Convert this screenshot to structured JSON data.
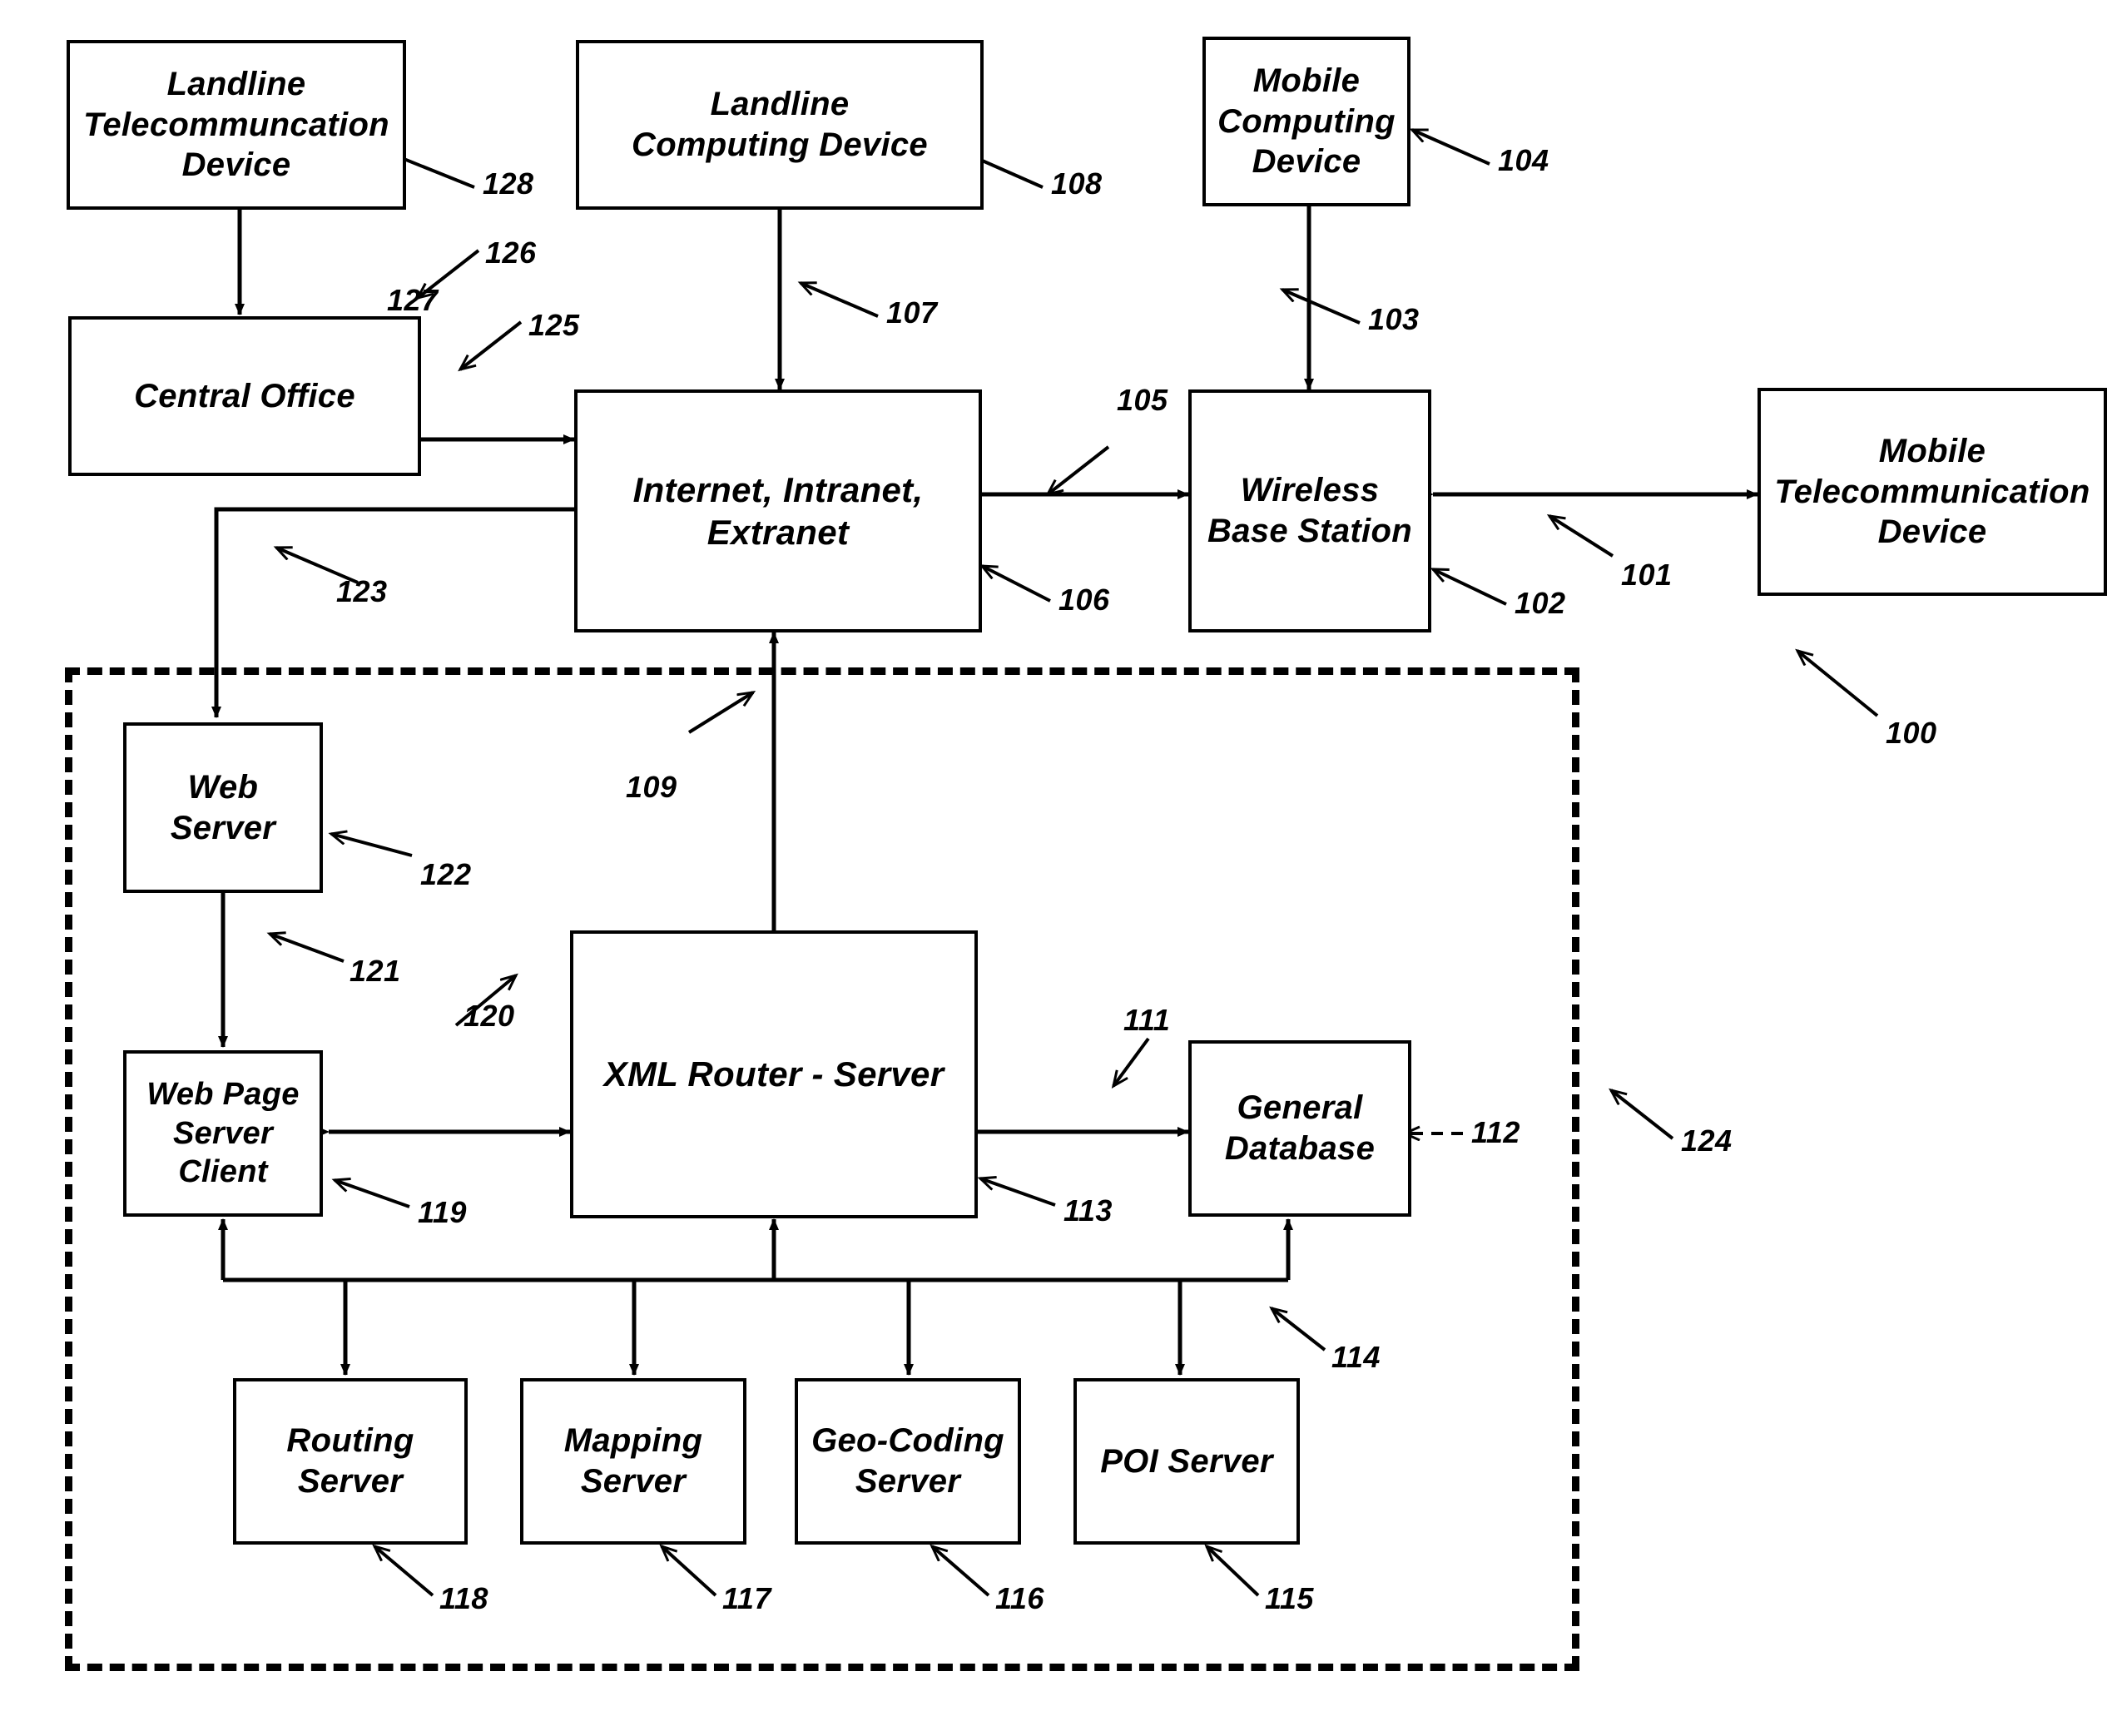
{
  "figure": {
    "type": "patent-system-block-diagram",
    "background_color": "#ffffff",
    "line_color": "#000000"
  },
  "nodes": [
    {
      "id": "n128",
      "label": "Landline\nTelecommuncation\nDevice",
      "ref": "128"
    },
    {
      "id": "n108",
      "label": "Landline\nComputing Device",
      "ref": "108"
    },
    {
      "id": "n104",
      "label": "Mobile\nComputing\nDevice",
      "ref": "104"
    },
    {
      "id": "n127",
      "label": "Central Office",
      "ref": "127"
    },
    {
      "id": "n106",
      "label": "Internet, Intranet,\nExtranet",
      "ref": "106"
    },
    {
      "id": "n102",
      "label": "Wireless\nBase Station",
      "ref": "102"
    },
    {
      "id": "n100",
      "label": "Mobile\nTelecommunication\nDevice",
      "ref": "100"
    },
    {
      "id": "n122",
      "label": "Web\nServer",
      "ref": "122"
    },
    {
      "id": "n119",
      "label": "Web Page\nServer\nClient",
      "ref": "119"
    },
    {
      "id": "n113",
      "label": "XML Router - Server",
      "ref": "113"
    },
    {
      "id": "n112",
      "label": "General\nDatabase",
      "ref": "112"
    },
    {
      "id": "n118",
      "label": "Routing\nServer",
      "ref": "118"
    },
    {
      "id": "n117",
      "label": "Mapping\nServer",
      "ref": "117"
    },
    {
      "id": "n116",
      "label": "Geo-Coding\nServer",
      "ref": "116"
    },
    {
      "id": "n115",
      "label": "POI Server",
      "ref": "115"
    }
  ],
  "node_labels": {
    "landline_telecom_device": "Landline\nTelecommuncation\nDevice",
    "landline_computing_device": "Landline\nComputing Device",
    "mobile_computing_device": "Mobile\nComputing\nDevice",
    "central_office": "Central Office",
    "internet": "Internet, Intranet,\nExtranet",
    "wireless_base_station": "Wireless\nBase Station",
    "mobile_telecom_device": "Mobile\nTelecommunication\nDevice",
    "web_server": "Web\nServer",
    "web_page_server_client": "Web Page\nServer\nClient",
    "xml_router_server": "XML Router - Server",
    "general_database": "General\nDatabase",
    "routing_server": "Routing\nServer",
    "mapping_server": "Mapping\nServer",
    "geo_coding_server": "Geo-Coding\nServer",
    "poi_server": "POI Server"
  },
  "reference_numerals": {
    "r100": "100",
    "r101": "101",
    "r102": "102",
    "r103": "103",
    "r104": "104",
    "r105": "105",
    "r106": "106",
    "r107": "107",
    "r108": "108",
    "r109": "109",
    "r111": "111",
    "r112": "112",
    "r113": "113",
    "r114": "114",
    "r115": "115",
    "r116": "116",
    "r117": "117",
    "r118": "118",
    "r119": "119",
    "r120": "120",
    "r121": "121",
    "r122": "122",
    "r123": "123",
    "r124": "124",
    "r125": "125",
    "r126": "126",
    "r127": "127",
    "r128": "128"
  }
}
